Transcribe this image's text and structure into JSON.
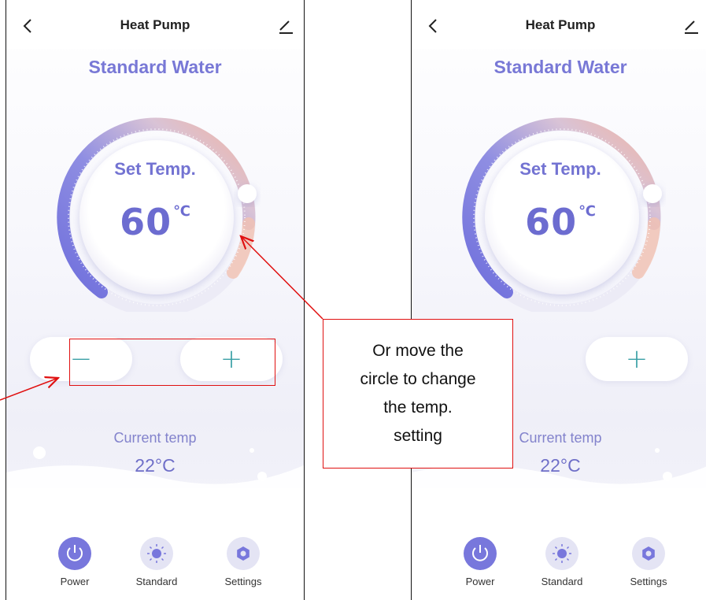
{
  "screens": [
    {
      "header": {
        "title": "Heat Pump"
      },
      "mode_title": "Standard Water",
      "dial": {
        "label": "Set Temp.",
        "value": "60",
        "unit": "℃"
      },
      "controls": {
        "minus": "−",
        "plus": "+"
      },
      "current": {
        "label": "Current temp",
        "value": "22°C"
      },
      "nav": [
        {
          "label": "Power",
          "icon": "power-icon",
          "active": true
        },
        {
          "label": "Standard",
          "icon": "sun-icon",
          "active": false
        },
        {
          "label": "Settings",
          "icon": "gear-icon",
          "active": false
        }
      ]
    },
    {
      "header": {
        "title": "Heat Pump"
      },
      "mode_title": "Standard Water",
      "dial": {
        "label": "Set Temp.",
        "value": "60",
        "unit": "℃"
      },
      "controls": {
        "plus": "+"
      },
      "current": {
        "label": "Current temp",
        "value": "22°C"
      },
      "nav": [
        {
          "label": "Power",
          "icon": "power-icon",
          "active": true
        },
        {
          "label": "Standard",
          "icon": "sun-icon",
          "active": false
        },
        {
          "label": "Settings",
          "icon": "gear-icon",
          "active": false
        }
      ]
    }
  ],
  "annotation": {
    "callout_lines": [
      "Or move the",
      "circle to change",
      "the temp.",
      "setting"
    ],
    "color": "#e01010"
  },
  "colors": {
    "accent": "#7877dc",
    "stepper": "#3aa0a6",
    "dial_warm": "#f0b8a6"
  }
}
